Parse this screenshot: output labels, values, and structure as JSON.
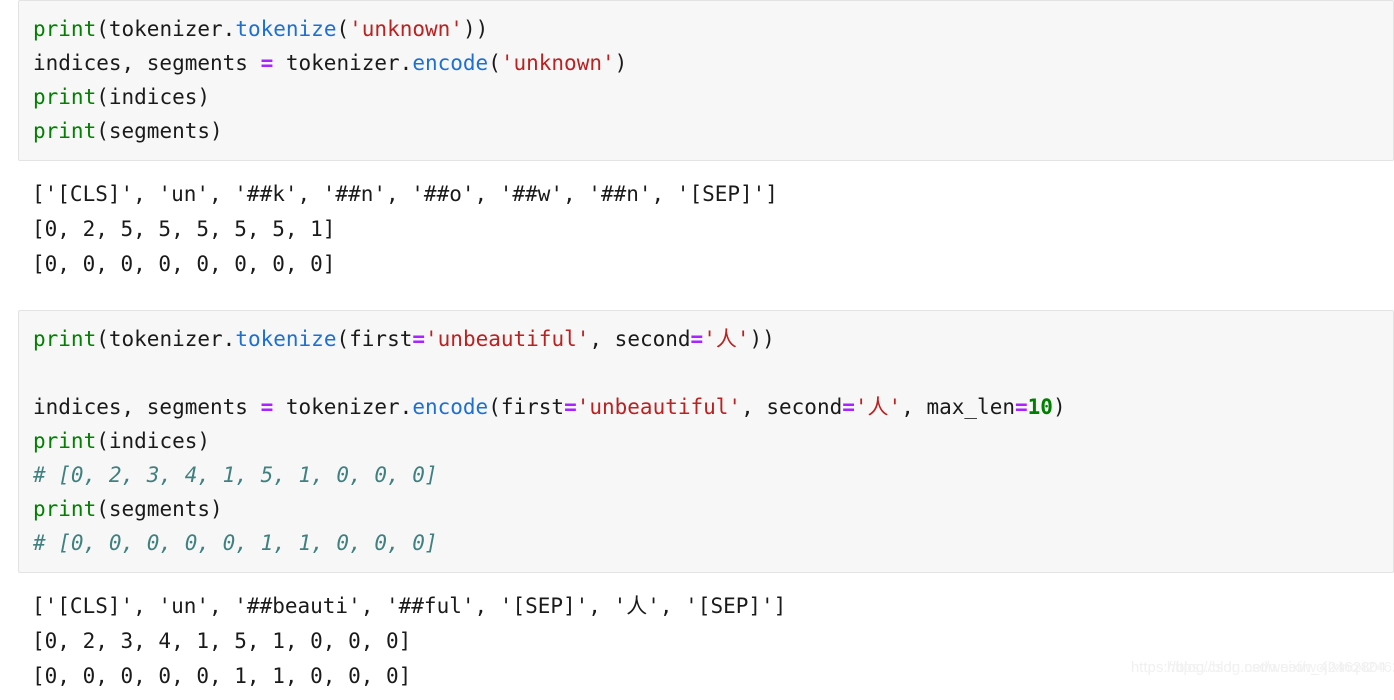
{
  "notebook": {
    "cells": [
      {
        "prompt": "]:",
        "code_lines": [
          [
            {
              "t": "print",
              "c": "builtin"
            },
            {
              "t": "(",
              "c": "punct"
            },
            {
              "t": "tokenizer",
              "c": "name"
            },
            {
              "t": ".",
              "c": "punct"
            },
            {
              "t": "tokenize",
              "c": "fn"
            },
            {
              "t": "(",
              "c": "punct"
            },
            {
              "t": "'unknown'",
              "c": "str"
            },
            {
              "t": "))",
              "c": "punct"
            }
          ],
          [
            {
              "t": "indices, segments ",
              "c": "name"
            },
            {
              "t": "=",
              "c": "op"
            },
            {
              "t": " tokenizer",
              "c": "name"
            },
            {
              "t": ".",
              "c": "punct"
            },
            {
              "t": "encode",
              "c": "fn"
            },
            {
              "t": "(",
              "c": "punct"
            },
            {
              "t": "'unknown'",
              "c": "str"
            },
            {
              "t": ")",
              "c": "punct"
            }
          ],
          [
            {
              "t": "print",
              "c": "builtin"
            },
            {
              "t": "(",
              "c": "punct"
            },
            {
              "t": "indices",
              "c": "name"
            },
            {
              "t": ")",
              "c": "punct"
            }
          ],
          [
            {
              "t": "print",
              "c": "builtin"
            },
            {
              "t": "(",
              "c": "punct"
            },
            {
              "t": "segments",
              "c": "name"
            },
            {
              "t": ")",
              "c": "punct"
            }
          ]
        ],
        "output_lines": [
          "['[CLS]', 'un', '##k', '##n', '##o', '##w', '##n', '[SEP]']",
          "[0, 2, 5, 5, 5, 5, 5, 1]",
          "[0, 0, 0, 0, 0, 0, 0, 0]"
        ]
      },
      {
        "prompt": "]:",
        "code_lines": [
          [
            {
              "t": "print",
              "c": "builtin"
            },
            {
              "t": "(",
              "c": "punct"
            },
            {
              "t": "tokenizer",
              "c": "name"
            },
            {
              "t": ".",
              "c": "punct"
            },
            {
              "t": "tokenize",
              "c": "fn"
            },
            {
              "t": "(",
              "c": "punct"
            },
            {
              "t": "first",
              "c": "name"
            },
            {
              "t": "=",
              "c": "op"
            },
            {
              "t": "'unbeautiful'",
              "c": "str"
            },
            {
              "t": ", second",
              "c": "name"
            },
            {
              "t": "=",
              "c": "op"
            },
            {
              "t": "'人'",
              "c": "str"
            },
            {
              "t": "))",
              "c": "punct"
            }
          ],
          [],
          [
            {
              "t": "indices, segments ",
              "c": "name"
            },
            {
              "t": "=",
              "c": "op"
            },
            {
              "t": " tokenizer",
              "c": "name"
            },
            {
              "t": ".",
              "c": "punct"
            },
            {
              "t": "encode",
              "c": "fn"
            },
            {
              "t": "(",
              "c": "punct"
            },
            {
              "t": "first",
              "c": "name"
            },
            {
              "t": "=",
              "c": "op"
            },
            {
              "t": "'unbeautiful'",
              "c": "str"
            },
            {
              "t": ", second",
              "c": "name"
            },
            {
              "t": "=",
              "c": "op"
            },
            {
              "t": "'人'",
              "c": "str"
            },
            {
              "t": ", max_len",
              "c": "name"
            },
            {
              "t": "=",
              "c": "op"
            },
            {
              "t": "10",
              "c": "num"
            },
            {
              "t": ")",
              "c": "punct"
            }
          ],
          [
            {
              "t": "print",
              "c": "builtin"
            },
            {
              "t": "(",
              "c": "punct"
            },
            {
              "t": "indices",
              "c": "name"
            },
            {
              "t": ")",
              "c": "punct"
            }
          ],
          [
            {
              "t": "# [0, 2, 3, 4, 1, 5, 1, 0, 0, 0]",
              "c": "comment"
            }
          ],
          [
            {
              "t": "print",
              "c": "builtin"
            },
            {
              "t": "(",
              "c": "punct"
            },
            {
              "t": "segments",
              "c": "name"
            },
            {
              "t": ")",
              "c": "punct"
            }
          ],
          [
            {
              "t": "# [0, 0, 0, 0, 0, 1, 1, 0, 0, 0]",
              "c": "comment"
            }
          ]
        ],
        "output_lines": [
          "['[CLS]', 'un', '##beauti', '##ful', '[SEP]', '人', '[SEP]']",
          "[0, 2, 3, 4, 1, 5, 1, 0, 0, 0]",
          "[0, 0, 0, 0, 0, 1, 1, 0, 0, 0]"
        ]
      }
    ]
  },
  "watermark": {
    "line_a": "https://blog.csdn.net/weixin_42462804",
    "line_b": "https://blog.csdn.net/wojixinq42462804"
  },
  "colors": {
    "cell_background": "#f7f7f7",
    "cell_border": "#e3e3e3",
    "page_background": "#ffffff",
    "text": "#1a1a1a",
    "builtin": "#008000",
    "function": "#1d6fd4",
    "string": "#ba2121",
    "operator": "#aa22ff",
    "number": "#008000",
    "comment": "#40807f",
    "prompt": "#9a9a9a"
  }
}
